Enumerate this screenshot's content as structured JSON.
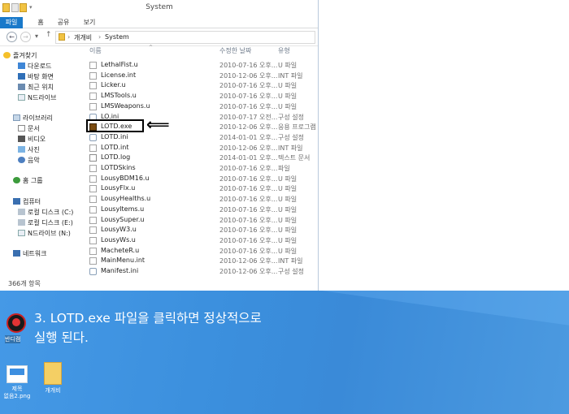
{
  "window": {
    "title": "System",
    "tabs": [
      "파일",
      "홈",
      "공유",
      "보기"
    ],
    "address": {
      "segments": [
        "개개비",
        "System"
      ]
    },
    "status": "366개 항목"
  },
  "nav": {
    "favorites": {
      "label": "즐겨찾기",
      "items": [
        "다운로드",
        "바탕 화면",
        "최근 위치",
        "N드라이브"
      ]
    },
    "libraries": {
      "label": "라이브러리",
      "items": [
        "문서",
        "비디오",
        "사진",
        "음악"
      ]
    },
    "homegroup": "홈 그룹",
    "computer": {
      "label": "컴퓨터",
      "items": [
        "로컬 디스크 (C:)",
        "로컬 디스크 (E:)",
        "N드라이브 (N:)"
      ]
    },
    "network": "네트워크"
  },
  "columns": {
    "name": "이름",
    "date": "수정한 날짜",
    "type": "유형"
  },
  "files": [
    {
      "name": "LethalFist.u",
      "date": "2010-07-16 오후...",
      "type": "U 파일",
      "icon": "file-icon"
    },
    {
      "name": "License.int",
      "date": "2010-12-06 오후...",
      "type": "INT 파일",
      "icon": "file-icon"
    },
    {
      "name": "Licker.u",
      "date": "2010-07-16 오후...",
      "type": "U 파일",
      "icon": "file-icon"
    },
    {
      "name": "LMSTools.u",
      "date": "2010-07-16 오후...",
      "type": "U 파일",
      "icon": "file-icon"
    },
    {
      "name": "LMSWeapons.u",
      "date": "2010-07-16 오후...",
      "type": "U 파일",
      "icon": "file-icon"
    },
    {
      "name": "LO.ini",
      "date": "2010-07-17 오전...",
      "type": "구성 설정",
      "icon": "ini-icon"
    },
    {
      "name": "LOTD.exe",
      "date": "2010-12-06 오후...",
      "type": "응용 프로그램",
      "icon": "exe-icon"
    },
    {
      "name": "LOTD.ini",
      "date": "2014-01-01 오후...",
      "type": "구성 설정",
      "icon": "ini-icon"
    },
    {
      "name": "LOTD.int",
      "date": "2010-12-06 오후...",
      "type": "INT 파일",
      "icon": "file-icon"
    },
    {
      "name": "LOTD.log",
      "date": "2014-01-01 오후...",
      "type": "텍스트 문서",
      "icon": "text-file-icon"
    },
    {
      "name": "LOTDSkins",
      "date": "2010-07-16 오후...",
      "type": "파일",
      "icon": "file-icon"
    },
    {
      "name": "LousyBDM16.u",
      "date": "2010-07-16 오후...",
      "type": "U 파일",
      "icon": "file-icon"
    },
    {
      "name": "LousyFlx.u",
      "date": "2010-07-16 오후...",
      "type": "U 파일",
      "icon": "file-icon"
    },
    {
      "name": "LousyHealths.u",
      "date": "2010-07-16 오후...",
      "type": "U 파일",
      "icon": "file-icon"
    },
    {
      "name": "LousyItems.u",
      "date": "2010-07-16 오후...",
      "type": "U 파일",
      "icon": "file-icon"
    },
    {
      "name": "LousySuper.u",
      "date": "2010-07-16 오후...",
      "type": "U 파일",
      "icon": "file-icon"
    },
    {
      "name": "LousyW3.u",
      "date": "2010-07-16 오후...",
      "type": "U 파일",
      "icon": "file-icon"
    },
    {
      "name": "LousyWs.u",
      "date": "2010-07-16 오후...",
      "type": "U 파일",
      "icon": "file-icon"
    },
    {
      "name": "MacheteR.u",
      "date": "2010-07-16 오후...",
      "type": "U 파일",
      "icon": "file-icon"
    },
    {
      "name": "MainMenu.int",
      "date": "2010-12-06 오후...",
      "type": "INT 파일",
      "icon": "file-icon"
    },
    {
      "name": "Manifest.ini",
      "date": "2010-12-06 오후...",
      "type": "구성 설정",
      "icon": "ini-icon"
    }
  ],
  "annotation": {
    "line1": "3. LOTD.exe 파일을 클릭하면 정상적으로",
    "line2": "실행 된다.",
    "arrow": "⟸"
  },
  "desktop": {
    "app_label": "반디캠",
    "png_label_1": "제목",
    "png_label_2": "없음2.png",
    "folder_label": "개개비"
  },
  "colors": {
    "ribbon_file_tab": "#1979ca",
    "desktop": "#3a89d6",
    "highlight_box": "#000000"
  }
}
